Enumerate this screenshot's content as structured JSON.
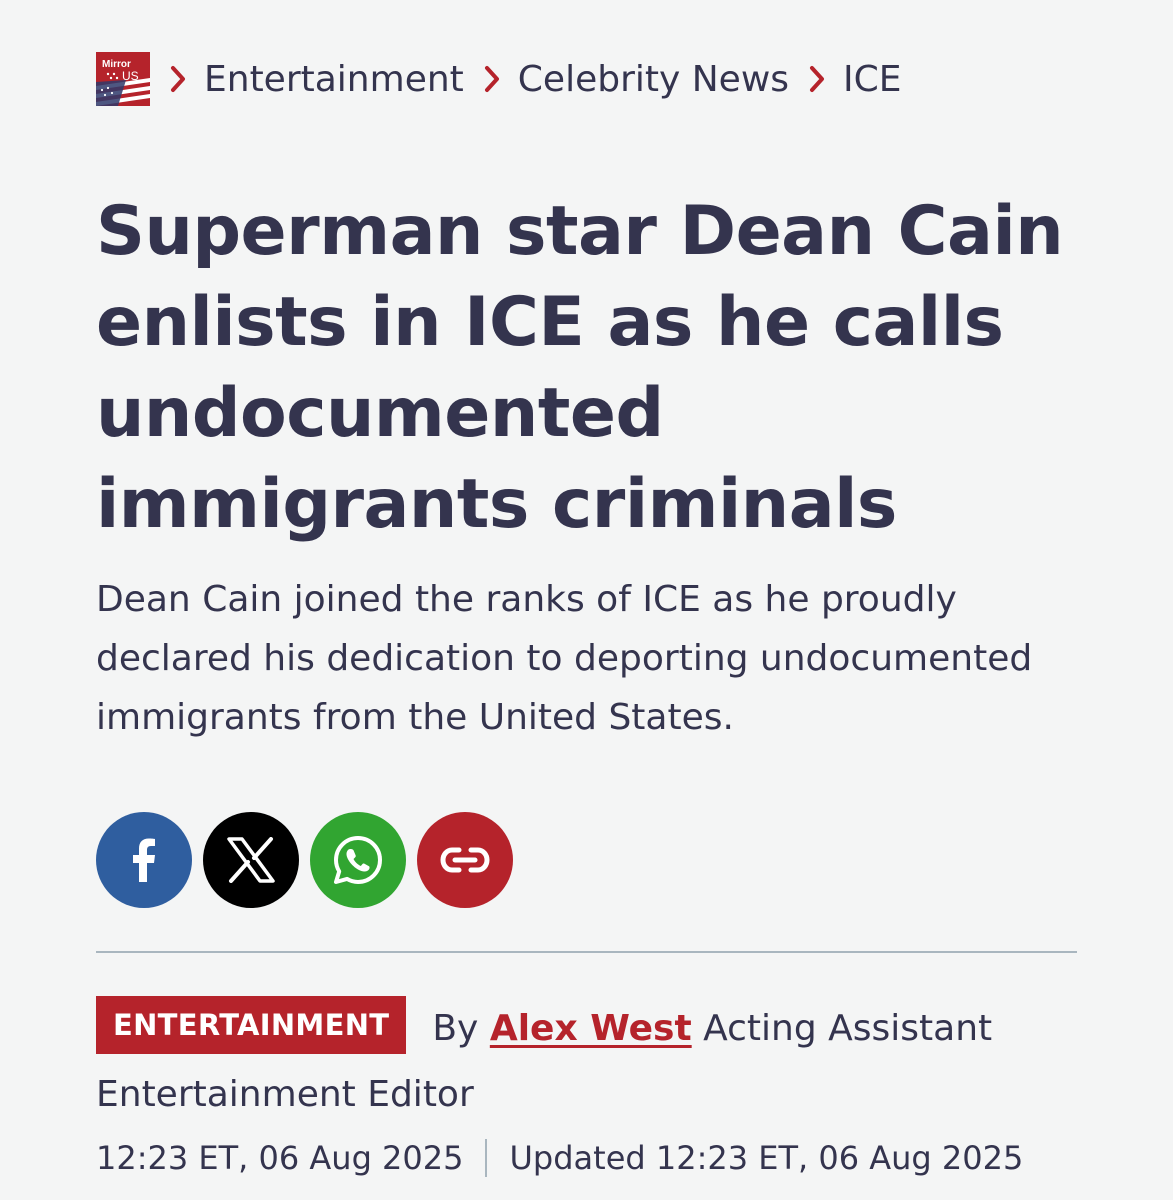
{
  "brand": {
    "logo_text": "Mirror US",
    "accent_color": "#b5232b",
    "text_color": "#34344e"
  },
  "breadcrumb": {
    "items": [
      {
        "label": "Entertainment"
      },
      {
        "label": "Celebrity News"
      },
      {
        "label": "ICE"
      }
    ],
    "separator_icon": "chevron-right-icon"
  },
  "article": {
    "headline": "Superman star Dean Cain enlists in ICE as he calls undocumented immigrants criminals",
    "standfirst": "Dean Cain joined the ranks of ICE as he proudly declared his dedication to deporting undocumented immigrants from the United States.",
    "category_tag": "ENTERTAINMENT",
    "by_prefix": "By",
    "author_name": "Alex West",
    "author_role": "Acting Assistant Entertainment Editor",
    "published": "12:23 ET, 06 Aug 2025",
    "updated": "Updated 12:23 ET, 06 Aug 2025"
  },
  "share": {
    "buttons": [
      {
        "icon": "facebook-icon",
        "color": "#2f5e9f"
      },
      {
        "icon": "x-icon",
        "color": "#000000"
      },
      {
        "icon": "whatsapp-icon",
        "color": "#31a531"
      },
      {
        "icon": "link-icon",
        "color": "#b5232b"
      }
    ]
  }
}
